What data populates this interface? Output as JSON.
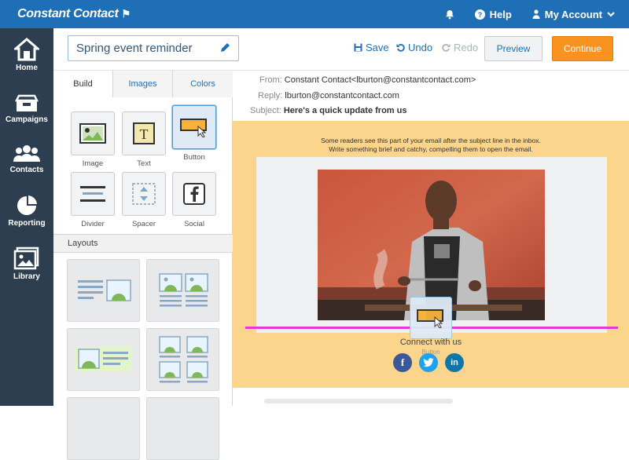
{
  "brand": {
    "name": "Constant Contact"
  },
  "topbar": {
    "notifications_icon": "bell-icon",
    "help": "Help",
    "account": "My Account"
  },
  "sidenav": {
    "items": [
      {
        "label": "Home",
        "icon": "home-icon"
      },
      {
        "label": "Campaigns",
        "icon": "campaigns-icon"
      },
      {
        "label": "Contacts",
        "icon": "contacts-icon"
      },
      {
        "label": "Reporting",
        "icon": "pie-chart-icon"
      },
      {
        "label": "Library",
        "icon": "library-icon"
      }
    ]
  },
  "editor": {
    "title": "Spring event reminder",
    "save": "Save",
    "undo": "Undo",
    "redo": "Redo",
    "preview": "Preview",
    "continue": "Continue"
  },
  "panel": {
    "tabs": [
      "Build",
      "Images",
      "Colors"
    ],
    "blocks": [
      "Image",
      "Text",
      "Button",
      "Divider",
      "Spacer",
      "Social"
    ],
    "layouts_header": "Layouts"
  },
  "email_header": {
    "from_label": "From:",
    "from_value": "Constant Contact<lburton@constantcontact.com>",
    "reply_label": "Reply:",
    "reply_value": "lburton@constantcontact.com",
    "subject_label": "Subject:",
    "subject_value": "Here's a quick update from us"
  },
  "email_body": {
    "preheader_line1": "Some readers see this part of your email after the subject line in the inbox.",
    "preheader_line2": "Write something brief and catchy, compelling them to open the email.",
    "connect": "Connect with us",
    "drag_label": "Button"
  },
  "colors": {
    "topbar": "#1f6fb6",
    "sidenav": "#2d3e50",
    "continue": "#f7931e",
    "canvas": "#fcd58d",
    "drop_line": "#e23bd1"
  }
}
